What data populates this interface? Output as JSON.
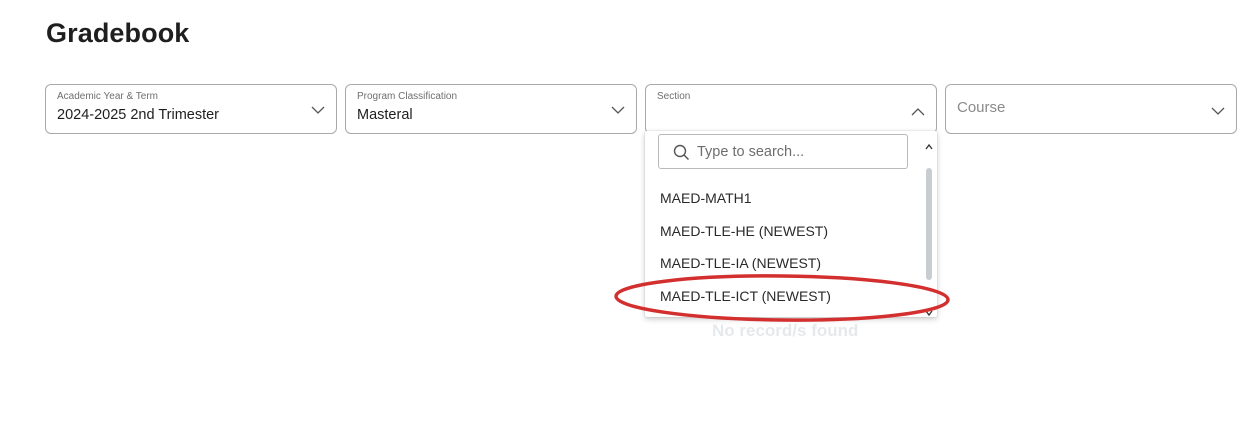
{
  "page": {
    "title": "Gradebook"
  },
  "filters": {
    "academic_year": {
      "label": "Academic Year & Term",
      "value": "2024-2025 2nd Trimester"
    },
    "program": {
      "label": "Program Classification",
      "value": "Masteral"
    },
    "section": {
      "label": "Section",
      "value": "",
      "open": true
    },
    "course": {
      "placeholder": "Course"
    }
  },
  "section_dropdown": {
    "search_placeholder": "Type to search...",
    "options": [
      "MAED-MATH1",
      "MAED-TLE-HE (NEWEST)",
      "MAED-TLE-IA (NEWEST)",
      "MAED-TLE-ICT (NEWEST)"
    ],
    "highlighted_option": "MAED-TLE-ICT (NEWEST)"
  },
  "empty_state": {
    "message": "No record/s found"
  },
  "colors": {
    "annotation_ellipse": "#d32f2f",
    "scroll_thumb": "#c8cdd2",
    "border": "#a9a9a9"
  },
  "icons": [
    "chevron-down-icon",
    "chevron-up-icon",
    "search-icon",
    "scroll-up-arrow-icon",
    "scroll-down-arrow-icon"
  ]
}
